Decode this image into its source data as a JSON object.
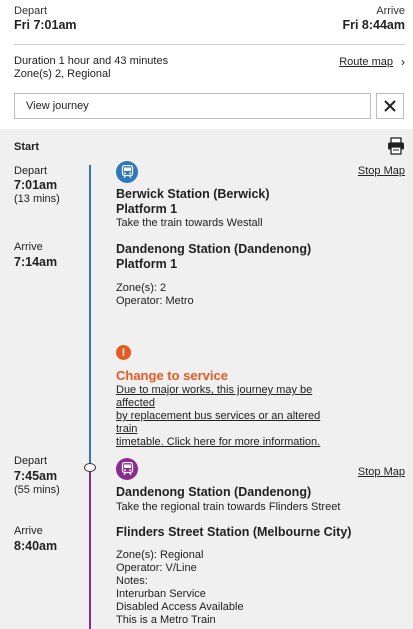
{
  "header": {
    "depart_label": "Depart",
    "depart_time": "Fri 7:01am",
    "arrive_label": "Arrive",
    "arrive_time": "Fri 8:44am"
  },
  "summary": {
    "duration": "Duration 1 hour and 43 minutes",
    "zones": "Zone(s) 2, Regional",
    "route_map_label": "Route map",
    "route_map_chevron": "›"
  },
  "view": {
    "placeholder": "View journey"
  },
  "journey": {
    "start_label": "Start",
    "legs": [
      {
        "mode": "train",
        "color": "#2b78c0",
        "depart_label": "Depart",
        "depart_time": "7:01am",
        "duration": "(13 mins)",
        "stop_map": "Stop Map",
        "from_station": "Berwick Station (Berwick)",
        "from_platform": "Platform 1",
        "direction": "Take the train towards Westall",
        "arrive_label": "Arrive",
        "arrive_time": "7:14am",
        "to_station": "Dandenong Station (Dandenong)",
        "to_platform": "Platform 1",
        "zones": "Zone(s): 2",
        "operator": "Operator: Metro"
      },
      {
        "mode": "regional-train",
        "color": "#8c2a8f",
        "depart_label": "Depart",
        "depart_time": "7:45am",
        "duration": "(55 mins)",
        "stop_map": "Stop Map",
        "from_station": "Dandenong Station (Dandenong)",
        "direction": "Take the regional train towards Flinders Street",
        "arrive_label": "Arrive",
        "arrive_time": "8:40am",
        "to_station": "Flinders Street Station (Melbourne City)",
        "zones": "Zone(s): Regional",
        "operator": "Operator: V/Line",
        "notes_label": "Notes:",
        "notes": [
          "Interurban Service",
          "Disabled Access Available",
          "This is a Metro Train"
        ]
      }
    ],
    "alert": {
      "icon": "!",
      "title": "Change to service",
      "lines": [
        "Due to major works, this journey may be affected",
        "by replacement bus services or an altered train",
        "timetable. Click here for more information."
      ],
      "color": "#e65a20"
    }
  }
}
